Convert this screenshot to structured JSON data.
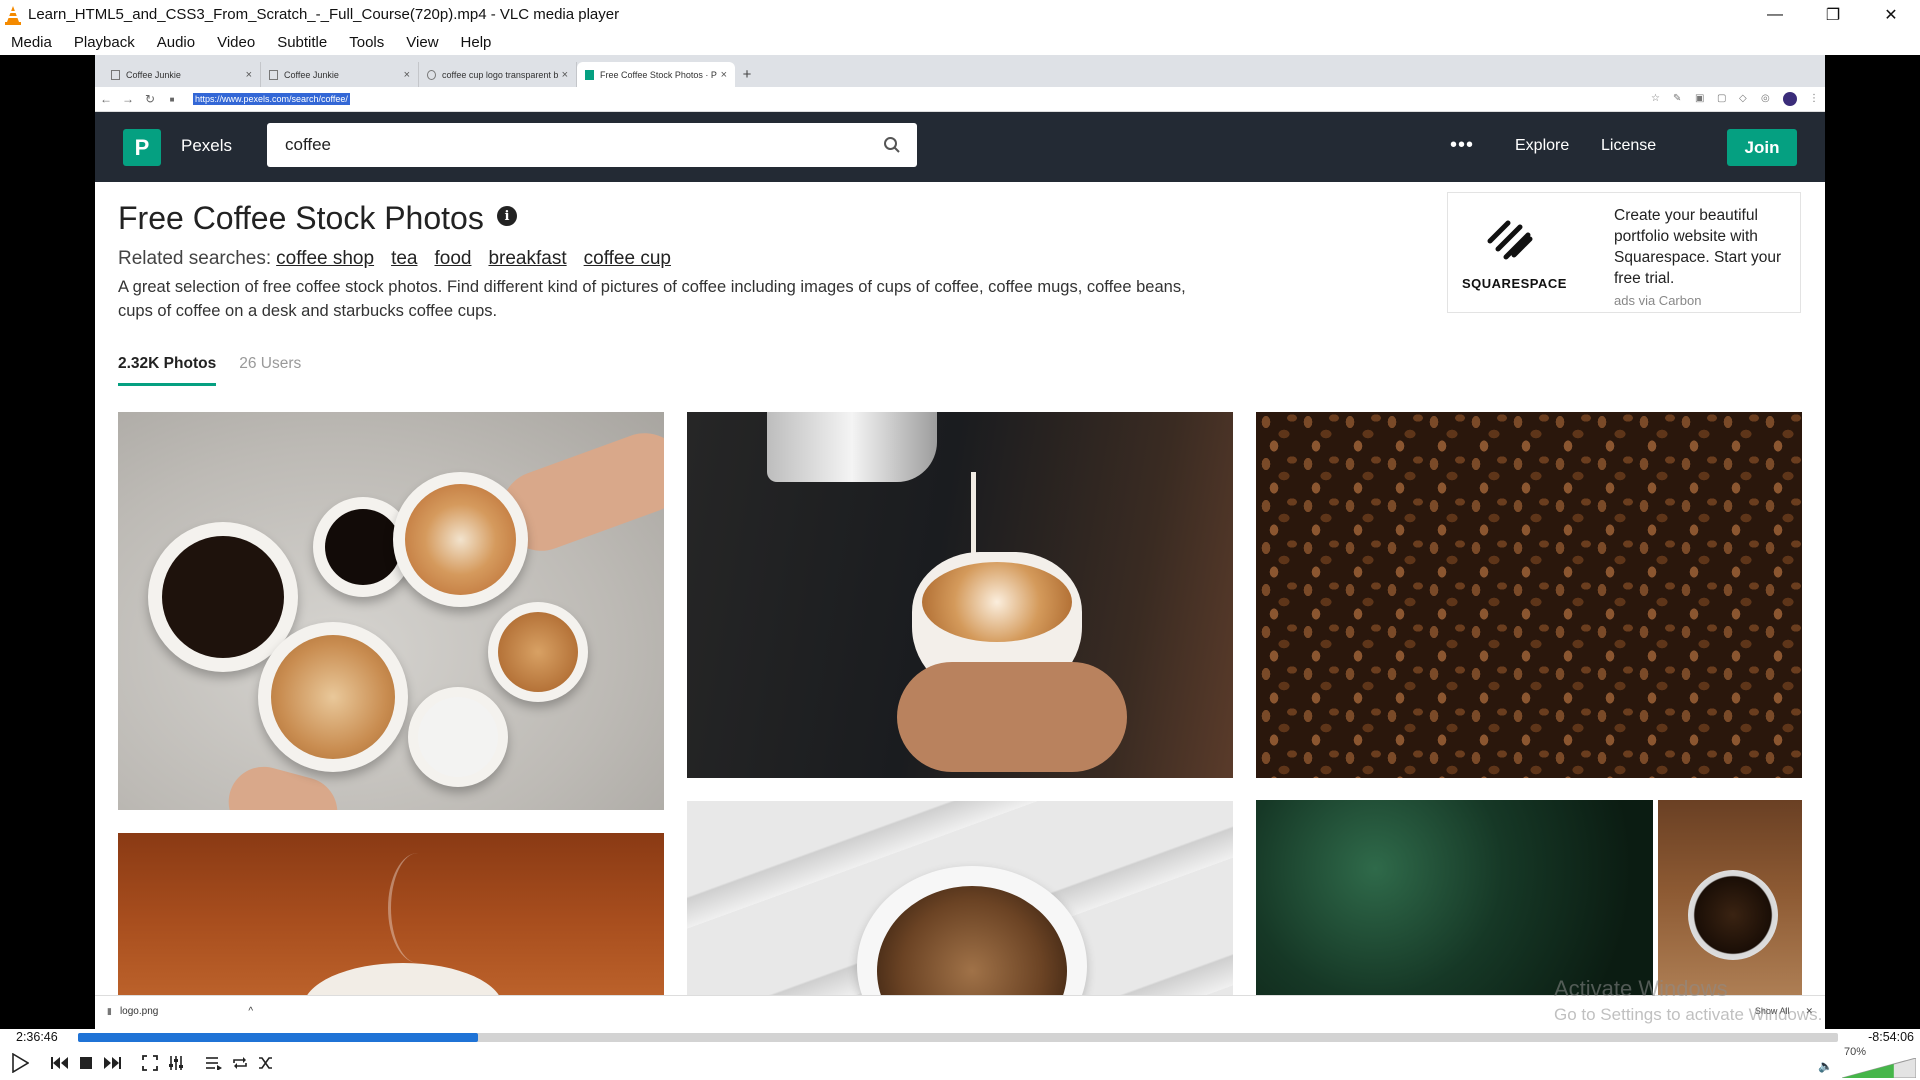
{
  "window": {
    "title": "Learn_HTML5_and_CSS3_From_Scratch_-_Full_Course(720p).mp4 - VLC media player",
    "minimize": "—",
    "restore": "❐",
    "close": "✕"
  },
  "menu": [
    "Media",
    "Playback",
    "Audio",
    "Video",
    "Subtitle",
    "Tools",
    "View",
    "Help"
  ],
  "browser": {
    "tabs": [
      {
        "label": "Coffee Junkie",
        "active": false
      },
      {
        "label": "Coffee Junkie",
        "active": false
      },
      {
        "label": "coffee cup logo transparent ba",
        "active": false
      },
      {
        "label": "Free Coffee Stock Photos · Pe",
        "active": true
      }
    ],
    "new_tab": "+",
    "url": "https://www.pexels.com/search/coffee/"
  },
  "pexels": {
    "logo_letter": "P",
    "brand": "Pexels",
    "search_value": "coffee",
    "nav": [
      "Explore",
      "License"
    ],
    "more": "•••",
    "join": "Join",
    "page_title": "Free Coffee Stock Photos",
    "info_glyph": "i",
    "related_label": "Related searches:",
    "related": [
      "coffee shop",
      "tea",
      "food",
      "breakfast",
      "coffee cup"
    ],
    "description": "A great selection of free coffee stock photos. Find different kind of pictures of coffee including images of cups of coffee, coffee mugs, coffee beans, cups of coffee on a desk and starbucks coffee cups.",
    "ad": {
      "brand": "SQUARESPACE",
      "text": "Create your beautiful portfolio website with Squarespace. Start your free trial.",
      "via": "ads via Carbon"
    },
    "content_tabs": [
      {
        "label": "2.32K Photos",
        "active": true
      },
      {
        "label": "26 Users",
        "active": false
      }
    ]
  },
  "downloads": {
    "file": "logo.png",
    "caret": "^",
    "show_all": "Show All",
    "close": "✕"
  },
  "watermark": {
    "line1": "Activate Windows",
    "line2": "Go to Settings to activate Windows."
  },
  "player": {
    "elapsed": "2:36:46",
    "remaining": "-8:54:06",
    "progress": 0.227,
    "volume": "70%",
    "accent": "#1f73d6"
  }
}
